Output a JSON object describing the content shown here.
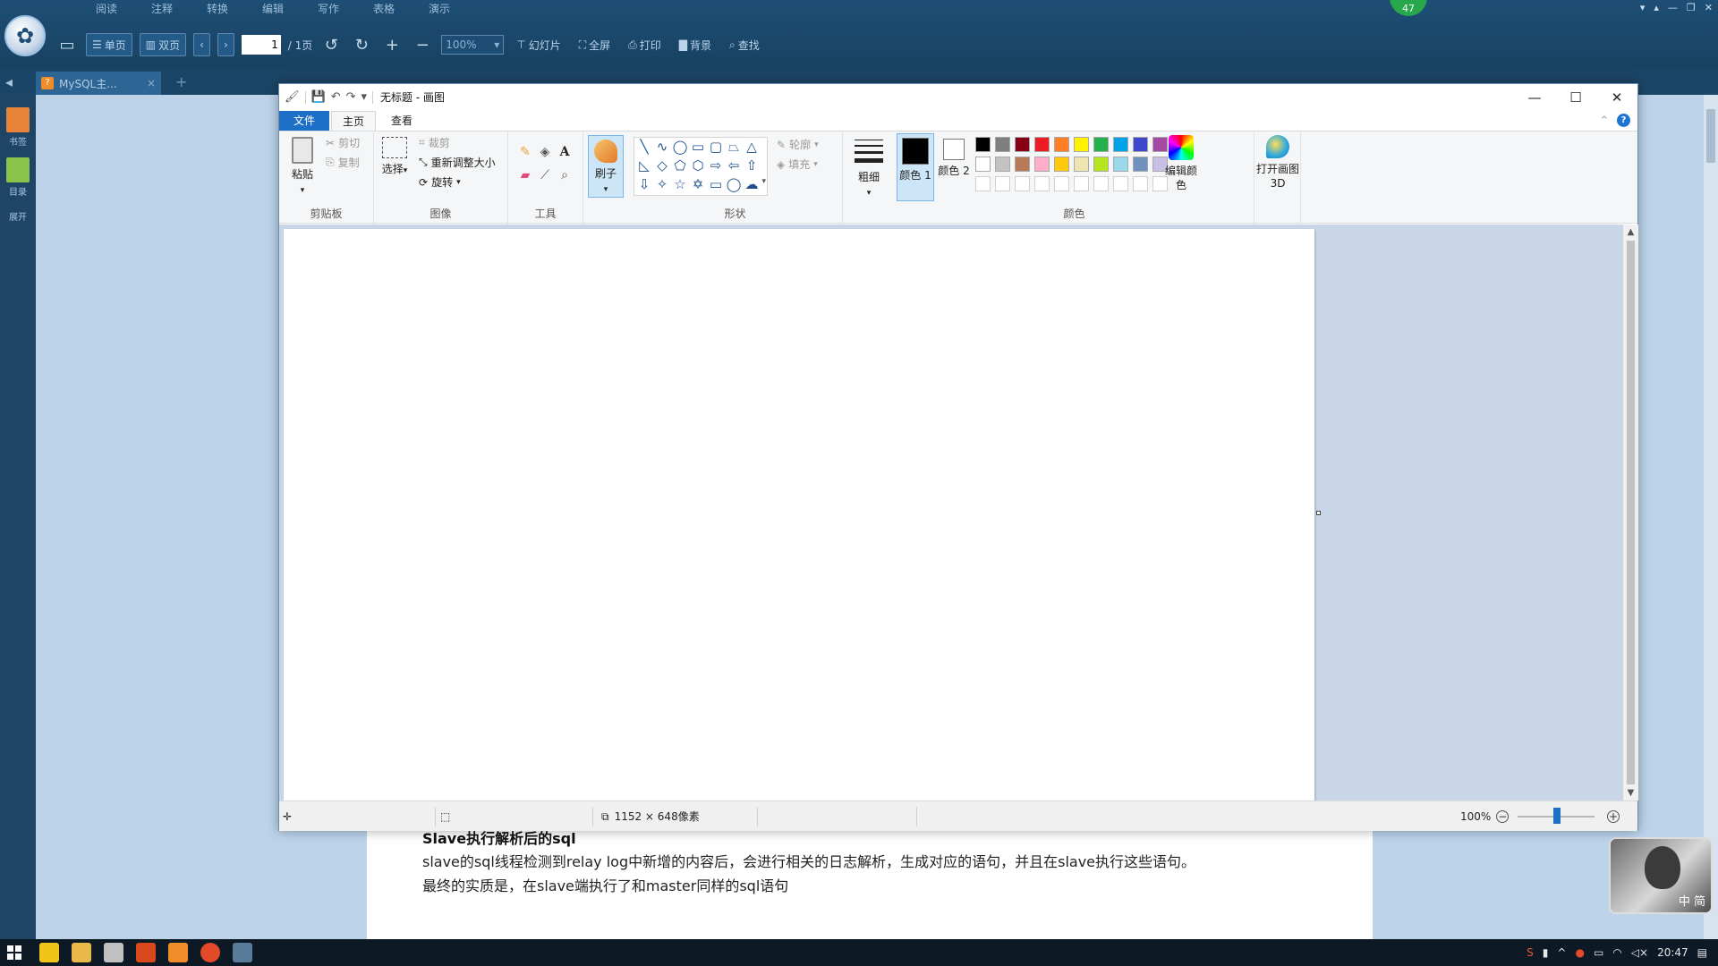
{
  "reader": {
    "menu": [
      "阅读",
      "注释",
      "转换",
      "编辑",
      "写作",
      "表格",
      "演示"
    ],
    "badge": "47",
    "toolbar": {
      "single_page": "单页",
      "double_page": "双页",
      "current_page": "1",
      "total_pages": "/ 1页",
      "zoom": "100%",
      "slideshow": "幻灯片",
      "fullscreen": "全屏",
      "print": "打印",
      "background": "背景",
      "find": "查找"
    },
    "tab": {
      "title": "MySQL主..."
    },
    "side": {
      "bookmarks": "书签",
      "toc": "目录",
      "expand": "展开"
    },
    "doc": {
      "heading": "Slave执行解析后的sql",
      "line1": "slave的sql线程检测到relay log中新增的内容后，会进行相关的日志解析，生成对应的语句，并且在slave执行这些语句。",
      "line2": "最终的实质是，在slave端执行了和master同样的sql语句"
    },
    "video_label": "中 简"
  },
  "paint": {
    "title": "无标题 - 画图",
    "tabs": {
      "file": "文件",
      "home": "主页",
      "view": "查看"
    },
    "clipboard": {
      "paste": "粘贴",
      "cut": "剪切",
      "copy": "复制",
      "label": "剪贴板"
    },
    "image": {
      "select": "选择",
      "crop": "裁剪",
      "resize": "重新调整大小",
      "rotate": "旋转",
      "label": "图像"
    },
    "tools": {
      "label": "工具"
    },
    "brush": {
      "label": "刷子"
    },
    "shapes": {
      "outline": "轮廓",
      "fill": "填充",
      "label": "形状"
    },
    "size": {
      "label": "粗细"
    },
    "colors": {
      "color1": "颜色 1",
      "color2": "颜色 2",
      "edit": "编辑颜色",
      "paint3d": "打开画图 3D",
      "label": "颜色",
      "row1": [
        "#000000",
        "#7f7f7f",
        "#880015",
        "#ed1c24",
        "#ff7f27",
        "#fff200",
        "#22b14c",
        "#00a2e8",
        "#3f48cc",
        "#a349a4"
      ],
      "row2": [
        "#ffffff",
        "#c3c3c3",
        "#b97a57",
        "#ffaec9",
        "#ffc90e",
        "#efe4b0",
        "#b5e61d",
        "#99d9ea",
        "#7092be",
        "#c8bfe7"
      ],
      "selected1": "#000000",
      "selected2": "#ffffff"
    },
    "status": {
      "dimensions": "1152 × 648像素",
      "zoom": "100%"
    }
  },
  "taskbar": {
    "time": "20:47"
  }
}
